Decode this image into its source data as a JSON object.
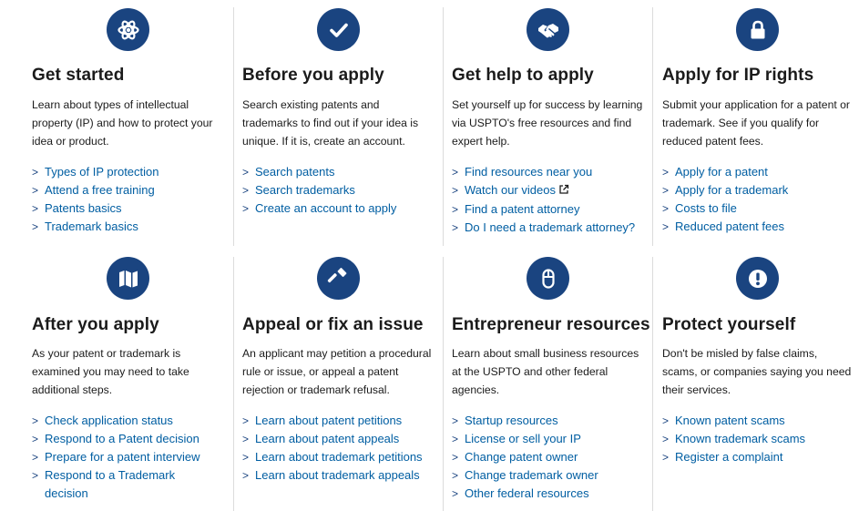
{
  "cards": [
    {
      "icon": "atom-icon",
      "title": "Get started",
      "desc": "Learn about types of intellectual property (IP) and how to protect your idea or product.",
      "links": [
        "Types of IP protection",
        "Attend a free training",
        "Patents basics",
        "Trademark basics"
      ]
    },
    {
      "icon": "checkmark-icon",
      "title": "Before you apply",
      "desc": "Search existing patents and trademarks to find out if your idea is unique. If it is, create an account.",
      "links": [
        "Search patents",
        "Search trademarks",
        "Create an account to apply"
      ]
    },
    {
      "icon": "handshake-icon",
      "title": "Get help to apply",
      "desc": "Set yourself up for success by learning via USPTO's free resources and find expert help.",
      "links": [
        "Find resources near you",
        "Watch our videos",
        "Find a patent attorney",
        "Do I need a trademark attorney?"
      ]
    },
    {
      "icon": "lock-icon",
      "title": "Apply for IP rights",
      "desc": "Submit your application for a patent or trademark. See if you qualify for reduced patent fees.",
      "links": [
        "Apply for a patent",
        "Apply for a trademark",
        "Costs to file",
        "Reduced patent fees"
      ]
    },
    {
      "icon": "map-icon",
      "title": "After you apply",
      "desc": "As your patent or trademark is examined you may need to take additional steps.",
      "links": [
        "Check application status",
        "Respond to a Patent decision",
        "Prepare for a patent interview",
        "Respond to a Trademark decision"
      ]
    },
    {
      "icon": "gavel-icon",
      "title": "Appeal or fix an issue",
      "desc": "An applicant may petition a procedural rule or issue, or appeal a patent rejection or trademark refusal.",
      "links": [
        "Learn about patent petitions",
        "Learn about patent appeals",
        "Learn about trademark petitions",
        "Learn about trademark appeals"
      ]
    },
    {
      "icon": "mouse-icon",
      "title": "Entrepreneur resources",
      "desc": "Learn about small business resources at the USPTO and other federal agencies.",
      "links": [
        "Startup resources",
        "License or sell your IP",
        "Change patent owner",
        "Change trademark owner",
        "Other federal resources"
      ]
    },
    {
      "icon": "exclamation-icon",
      "title": "Protect yourself",
      "desc": "Don't be misled by false claims, scams, or companies saying you need their services.",
      "links": [
        "Known patent scams",
        "Known trademark scams",
        "Register a complaint"
      ]
    }
  ],
  "chevron": ">",
  "colors": {
    "icon_bg": "#1a4480",
    "link": "#005ea2",
    "text": "#1b1b1b",
    "divider": "#dcdcdc"
  }
}
